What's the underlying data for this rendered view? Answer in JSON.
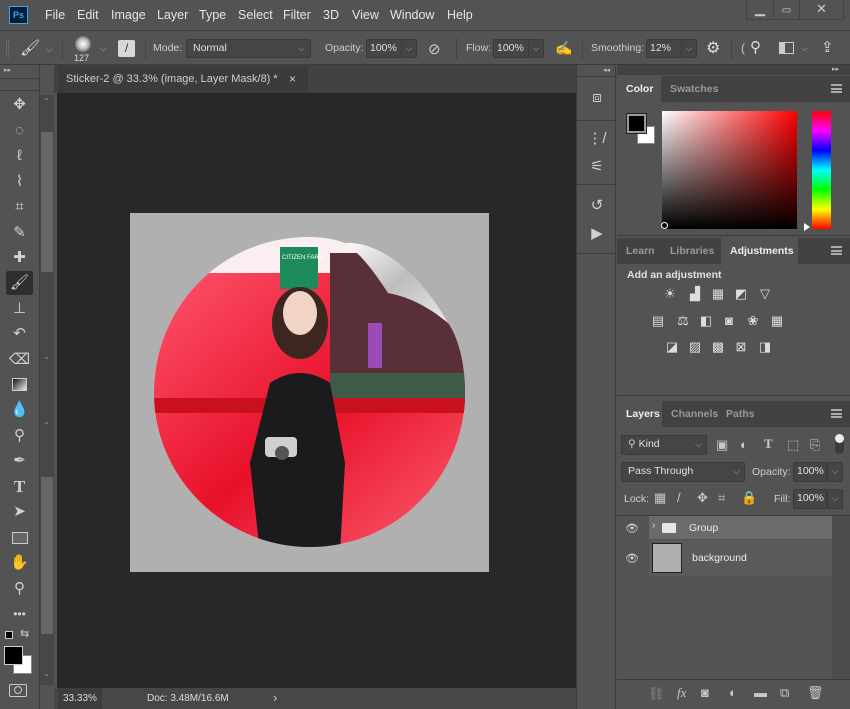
{
  "app": {
    "logo": "Ps"
  },
  "menu": [
    "File",
    "Edit",
    "Image",
    "Layer",
    "Type",
    "Select",
    "Filter",
    "3D",
    "View",
    "Window",
    "Help"
  ],
  "window_controls": {
    "minimize": "minimize-icon",
    "maximize": "maximize-icon",
    "close": "close-icon"
  },
  "options": {
    "brush_size": "127",
    "mode_label": "Mode:",
    "mode_value": "Normal",
    "opacity_label": "Opacity:",
    "opacity_value": "100%",
    "flow_label": "Flow:",
    "flow_value": "100%",
    "smoothing_label": "Smoothing:",
    "smoothing_value": "12%",
    "angle_glyph": "("
  },
  "document": {
    "tab_title": "Sticker-2 @ 33.3% (image, Layer Mask/8) *",
    "close_glyph": "×",
    "sign_text": "CITIZEN FARM"
  },
  "status": {
    "zoom": "33.33%",
    "doc": "Doc: 3.48M/16.6M",
    "arrow": "›"
  },
  "color_panel": {
    "tabs": [
      "Color",
      "Swatches"
    ],
    "active_tab": "Color",
    "foreground": "#000000",
    "background": "#ffffff",
    "hue": "#ff0000"
  },
  "adjustments_panel": {
    "tabs": [
      "Learn",
      "Libraries",
      "Adjustments"
    ],
    "active_tab": "Adjustments",
    "heading": "Add an adjustment",
    "rows": [
      [
        "brightness-contrast",
        "levels",
        "curves",
        "exposure",
        "vibrance"
      ],
      [
        "hue-saturation",
        "color-balance",
        "black-white",
        "photo-filter",
        "channel-mixer",
        "color-lookup"
      ],
      [
        "invert",
        "posterize",
        "threshold",
        "selective-color",
        "gradient-map"
      ]
    ]
  },
  "layers_panel": {
    "tabs": [
      "Layers",
      "Channels",
      "Paths"
    ],
    "active_tab": "Layers",
    "filter_label": "Kind",
    "blend_mode": "Pass Through",
    "opacity_label": "Opacity:",
    "opacity_value": "100%",
    "lock_label": "Lock:",
    "fill_label": "Fill:",
    "fill_value": "100%",
    "layers": [
      {
        "name": "Group",
        "type": "group",
        "visible": true,
        "selected": true
      },
      {
        "name": "background",
        "type": "layer",
        "visible": true,
        "selected": false
      }
    ],
    "footer_icons": [
      "link",
      "fx",
      "add-mask",
      "adjustment-layer",
      "new-group",
      "new-layer",
      "delete"
    ]
  },
  "tools": [
    "move",
    "marquee",
    "lasso",
    "quick-select",
    "crop",
    "eyedropper",
    "healing",
    "brush",
    "stamp",
    "history-brush",
    "eraser",
    "gradient",
    "blur",
    "dodge",
    "pen",
    "type",
    "path-select",
    "rectangle",
    "hand",
    "zoom",
    "more"
  ],
  "active_tool": "brush"
}
